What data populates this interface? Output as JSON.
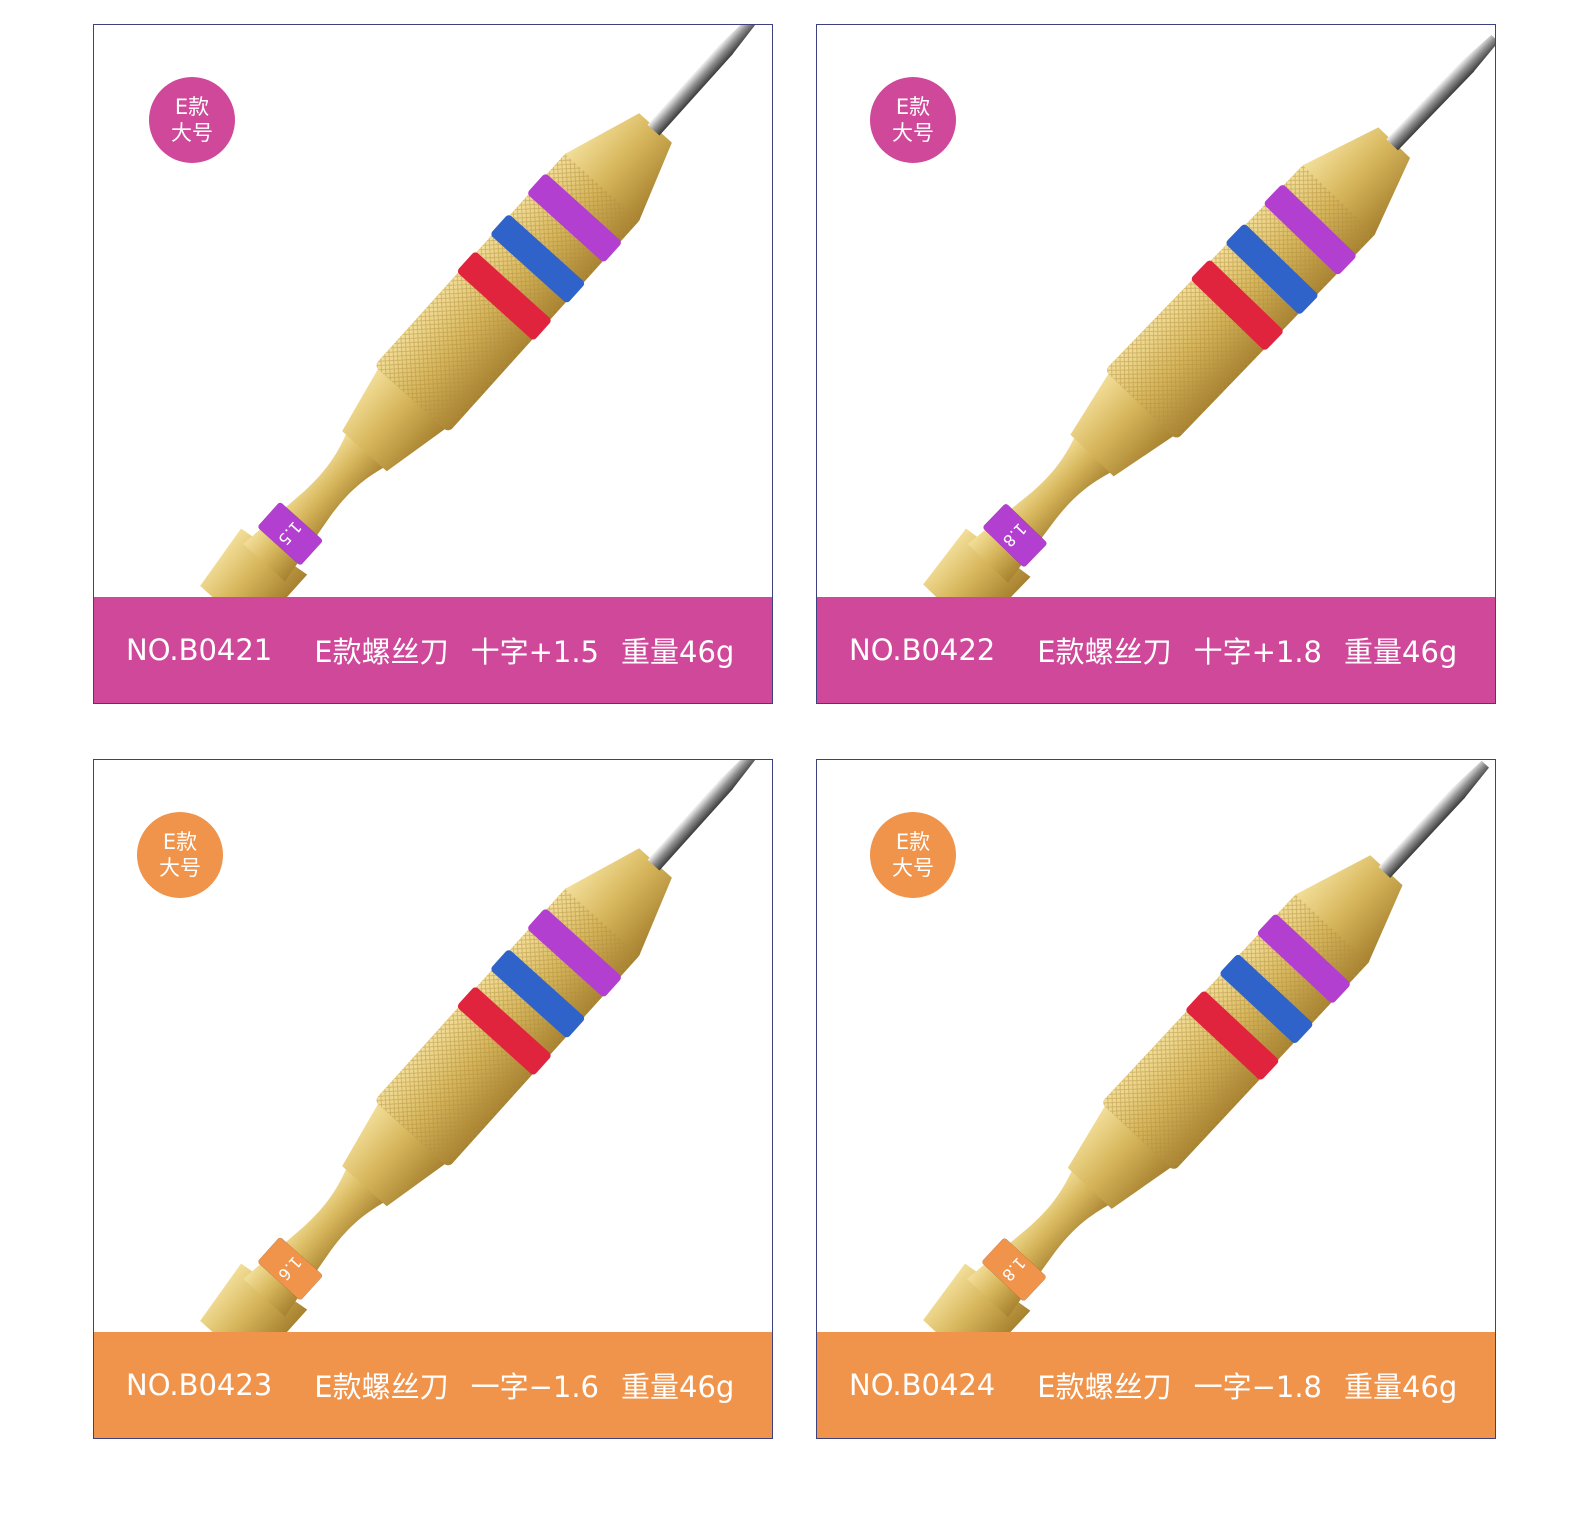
{
  "colors": {
    "magenta": "#d0489a",
    "orange": "#f0934b",
    "border": "#3d4180"
  },
  "cards": [
    {
      "badge_line1": "E款",
      "badge_line2": "大号",
      "code": "NO.B0421",
      "name": "E款螺丝刀",
      "spec": "十字+1.5",
      "weight": "重量46g",
      "ring_label": "1.5",
      "tip": "cross-tip-icon"
    },
    {
      "badge_line1": "E款",
      "badge_line2": "大号",
      "code": "NO.B0422",
      "name": "E款螺丝刀",
      "spec": "十字+1.8",
      "weight": "重量46g",
      "ring_label": "1.8",
      "tip": "cross-tip-icon"
    },
    {
      "badge_line1": "E款",
      "badge_line2": "大号",
      "code": "NO.B0423",
      "name": "E款螺丝刀",
      "spec": "一字−1.6",
      "weight": "重量46g",
      "ring_label": "1.6",
      "tip": "flat-tip-icon"
    },
    {
      "badge_line1": "E款",
      "badge_line2": "大号",
      "code": "NO.B0424",
      "name": "E款螺丝刀",
      "spec": "一字−1.8",
      "weight": "重量46g",
      "ring_label": "1.8",
      "tip": "flat-tip-icon"
    }
  ]
}
